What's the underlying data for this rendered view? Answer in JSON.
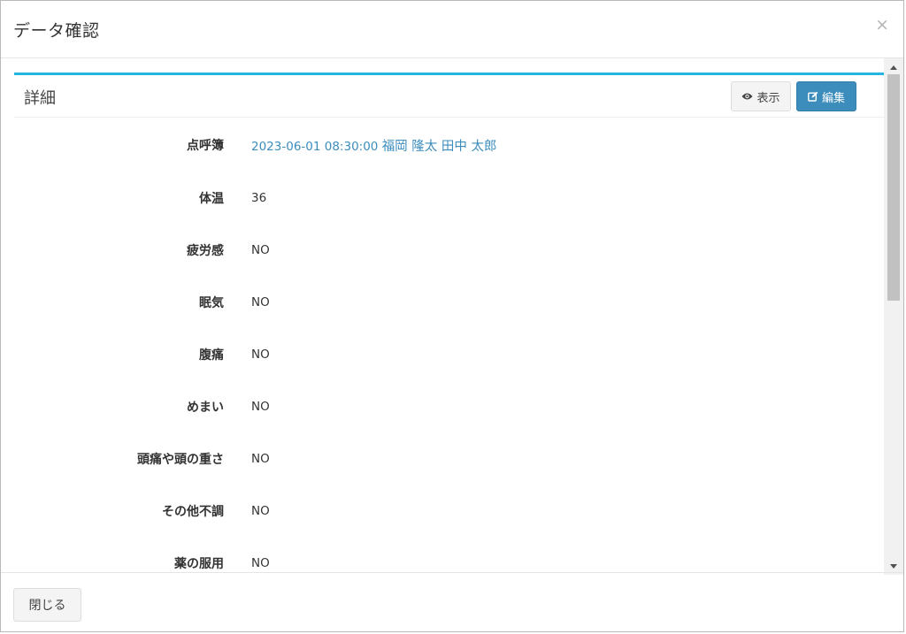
{
  "modal": {
    "title": "データ確認",
    "close_symbol": "×",
    "footer_close_label": "閉じる"
  },
  "box": {
    "title": "詳細",
    "view_label": "表示",
    "edit_label": "編集",
    "accent_color": "#25b5e0"
  },
  "fields": [
    {
      "label": "点呼簿",
      "value_datetime": "2023-06-01 08:30:00",
      "value_names": "福岡 隆太 田中 太郎"
    },
    {
      "label": "体温",
      "value": "36"
    },
    {
      "label": "疲労感",
      "value": "NO"
    },
    {
      "label": "眠気",
      "value": "NO"
    },
    {
      "label": "腹痛",
      "value": "NO"
    },
    {
      "label": "めまい",
      "value": "NO"
    },
    {
      "label": "頭痛や頭の重さ",
      "value": "NO"
    },
    {
      "label": "その他不調",
      "value": "NO"
    },
    {
      "label": "薬の服用",
      "value": "NO"
    }
  ],
  "colors": {
    "primary": "#3c8dbc",
    "link": "#3c8dbc"
  }
}
